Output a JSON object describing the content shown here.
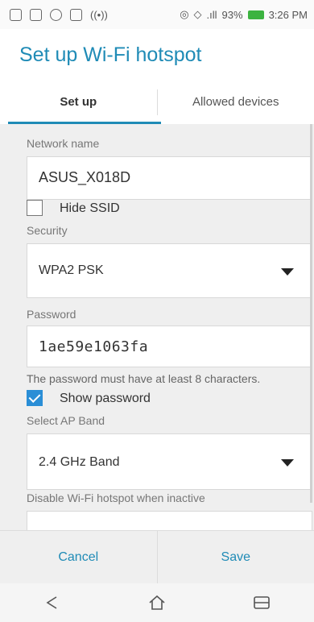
{
  "status": {
    "battery": "93%",
    "time": "3:26 PM"
  },
  "title": "Set up Wi-Fi hotspot",
  "tabs": [
    {
      "label": "Set up"
    },
    {
      "label": "Allowed devices"
    }
  ],
  "network_name": {
    "label": "Network name",
    "value": "ASUS_X018D"
  },
  "hide_ssid": {
    "label": "Hide SSID",
    "checked": false
  },
  "security": {
    "label": "Security",
    "value": "WPA2 PSK"
  },
  "password": {
    "label": "Password",
    "value": "1ae59e1063fa",
    "hint": "The password must have at least 8 characters."
  },
  "show_password": {
    "label": "Show password",
    "checked": true
  },
  "ap_band": {
    "label": "Select AP Band",
    "value": "2.4 GHz Band"
  },
  "disable_inactive": {
    "label": "Disable Wi-Fi hotspot when inactive"
  },
  "actions": {
    "cancel": "Cancel",
    "save": "Save"
  },
  "colors": {
    "accent": "#1f8bb6",
    "checkbox": "#2a8ed6"
  }
}
